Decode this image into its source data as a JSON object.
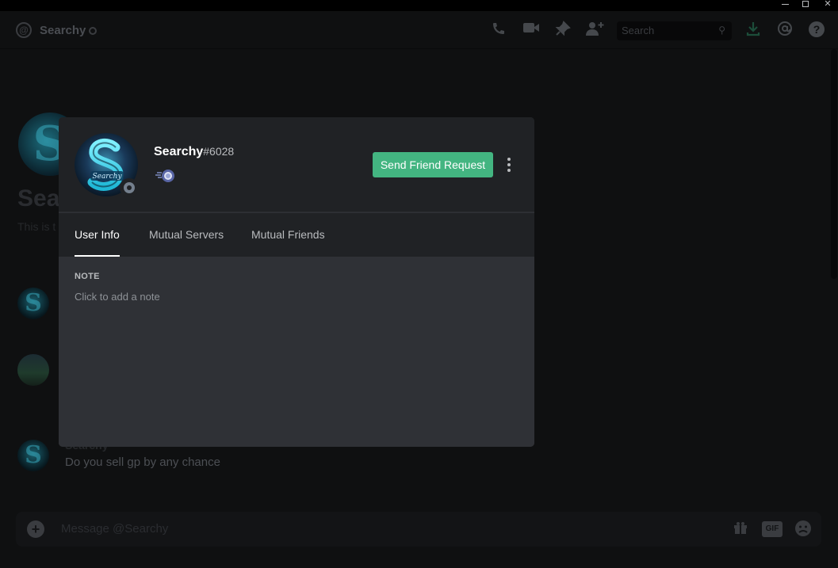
{
  "window": {
    "minimize": "",
    "maximize": "",
    "close": "✕"
  },
  "header": {
    "channel_name": "Searchy",
    "search_placeholder": "Search",
    "icons": [
      "phone-call-icon",
      "video-icon",
      "pin-icon",
      "add-friend-icon",
      "download-icon",
      "mention-icon",
      "help-icon"
    ]
  },
  "background": {
    "big_name": "Sea",
    "subtitle": "This is t",
    "message_author": "Searchy",
    "message_text": "Do you sell gp by any chance",
    "composer_placeholder": "Message @Searchy",
    "gif_label": "GIF"
  },
  "profile": {
    "username": "Searchy",
    "discriminator": "#6028",
    "status": "offline",
    "send_button": "Send Friend Request",
    "tabs": [
      {
        "label": "User Info",
        "active": true
      },
      {
        "label": "Mutual Servers",
        "active": false
      },
      {
        "label": "Mutual Friends",
        "active": false
      }
    ],
    "note_heading": "NOTE",
    "note_placeholder": "Click to add a note"
  },
  "colors": {
    "send_button": "#43b581",
    "modal_header": "#202225",
    "modal_body": "#2f3136"
  }
}
